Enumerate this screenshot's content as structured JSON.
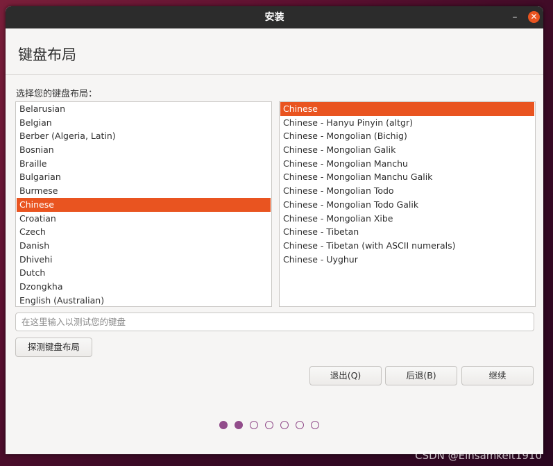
{
  "window": {
    "title": "安装",
    "minimize_glyph": "–",
    "close_glyph": "✕"
  },
  "header": {
    "title": "键盘布局"
  },
  "main": {
    "prompt": "选择您的键盘布局：",
    "layouts": [
      {
        "label": "Belarusian",
        "selected": false
      },
      {
        "label": "Belgian",
        "selected": false
      },
      {
        "label": "Berber (Algeria, Latin)",
        "selected": false
      },
      {
        "label": "Bosnian",
        "selected": false
      },
      {
        "label": "Braille",
        "selected": false
      },
      {
        "label": "Bulgarian",
        "selected": false
      },
      {
        "label": "Burmese",
        "selected": false
      },
      {
        "label": "Chinese",
        "selected": true
      },
      {
        "label": "Croatian",
        "selected": false
      },
      {
        "label": "Czech",
        "selected": false
      },
      {
        "label": "Danish",
        "selected": false
      },
      {
        "label": "Dhivehi",
        "selected": false
      },
      {
        "label": "Dutch",
        "selected": false
      },
      {
        "label": "Dzongkha",
        "selected": false
      },
      {
        "label": "English (Australian)",
        "selected": false
      }
    ],
    "variants": [
      {
        "label": "Chinese",
        "selected": true
      },
      {
        "label": "Chinese - Hanyu Pinyin (altgr)",
        "selected": false
      },
      {
        "label": "Chinese - Mongolian (Bichig)",
        "selected": false
      },
      {
        "label": "Chinese - Mongolian Galik",
        "selected": false
      },
      {
        "label": "Chinese - Mongolian Manchu",
        "selected": false
      },
      {
        "label": "Chinese - Mongolian Manchu Galik",
        "selected": false
      },
      {
        "label": "Chinese - Mongolian Todo",
        "selected": false
      },
      {
        "label": "Chinese - Mongolian Todo Galik",
        "selected": false
      },
      {
        "label": "Chinese - Mongolian Xibe",
        "selected": false
      },
      {
        "label": "Chinese - Tibetan",
        "selected": false
      },
      {
        "label": "Chinese - Tibetan (with ASCII numerals)",
        "selected": false
      },
      {
        "label": "Chinese - Uyghur",
        "selected": false
      }
    ],
    "test_input": {
      "value": "",
      "placeholder": "在这里输入以测试您的键盘"
    },
    "detect_button": "探测键盘布局"
  },
  "footer": {
    "quit_label": "退出(Q)",
    "back_label": "后退(B)",
    "continue_label": "继续"
  },
  "progress": {
    "total_steps": 7,
    "completed_steps": 2
  },
  "watermark": "CSDN @Einsamkeit1910",
  "colors": {
    "accent": "#e95420",
    "titlebar": "#2c2c2c",
    "progress_dot": "#924d8b"
  }
}
